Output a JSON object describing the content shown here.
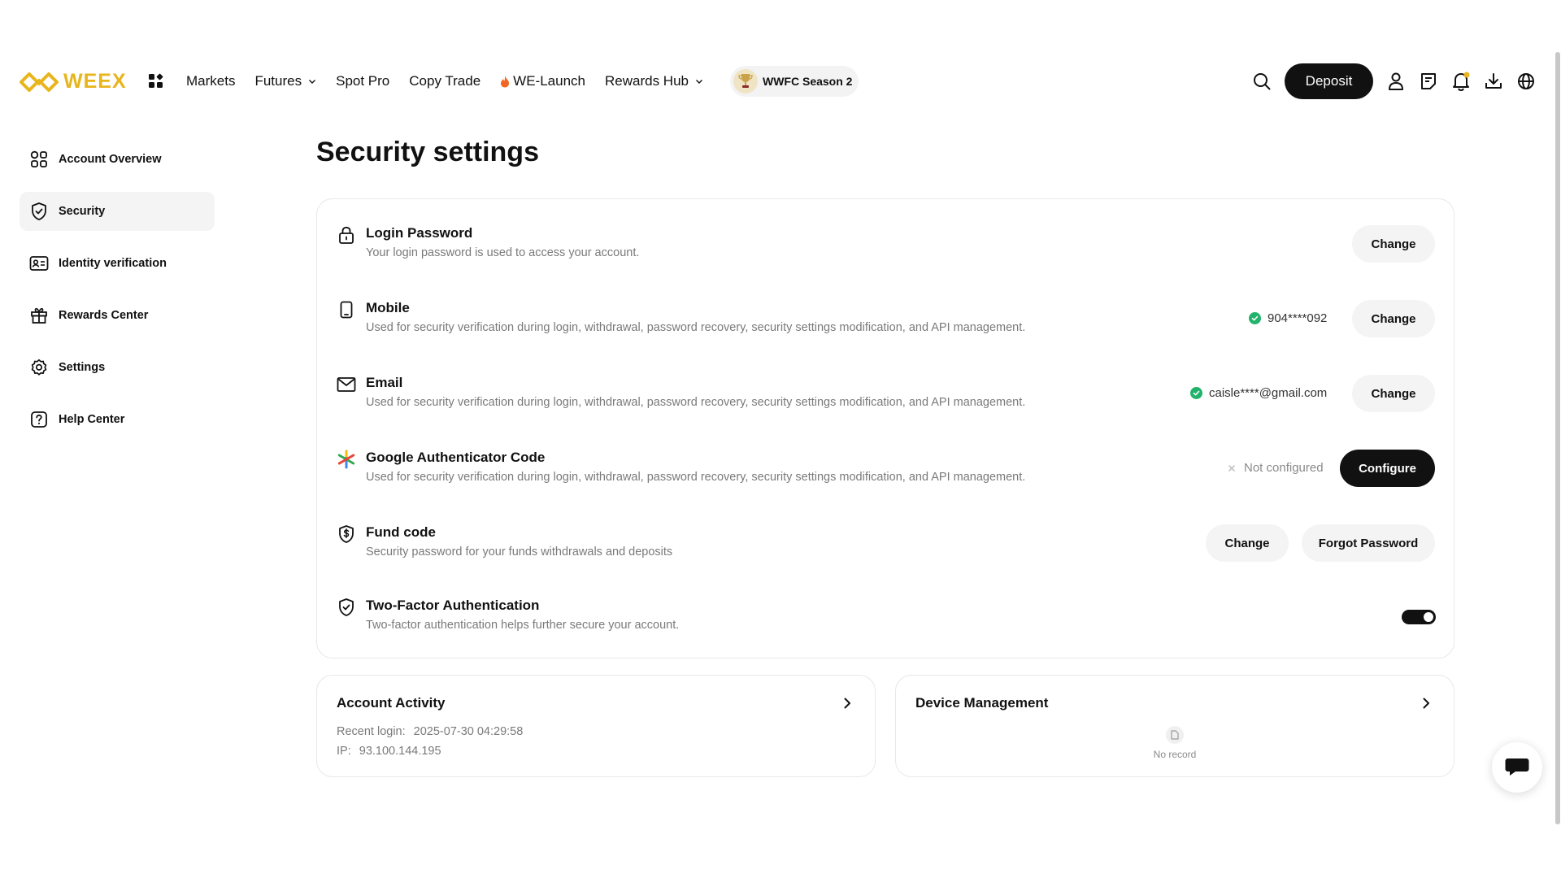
{
  "brand": {
    "name": "WEEX",
    "accent": "#e8b51c"
  },
  "nav": {
    "items": [
      {
        "label": "Markets",
        "has_dropdown": false
      },
      {
        "label": "Futures",
        "has_dropdown": true
      },
      {
        "label": "Spot Pro",
        "has_dropdown": false
      },
      {
        "label": "Copy Trade",
        "has_dropdown": false
      },
      {
        "label": "WE-Launch",
        "has_dropdown": false,
        "icon": "flame-icon"
      },
      {
        "label": "Rewards Hub",
        "has_dropdown": true
      }
    ],
    "season_label": "WWFC Season 2",
    "deposit_label": "Deposit",
    "icons": [
      "search-icon",
      "user-icon",
      "orders-icon",
      "bell-icon",
      "download-icon",
      "globe-icon"
    ]
  },
  "sidebar": {
    "items": [
      {
        "label": "Account Overview",
        "icon": "grid-icon",
        "active": false
      },
      {
        "label": "Security",
        "icon": "shield-icon",
        "active": true
      },
      {
        "label": "Identity verification",
        "icon": "id-card-icon",
        "active": false
      },
      {
        "label": "Rewards Center",
        "icon": "gift-icon",
        "active": false
      },
      {
        "label": "Settings",
        "icon": "gear-icon",
        "active": false
      },
      {
        "label": "Help Center",
        "icon": "help-icon",
        "active": false
      }
    ]
  },
  "page": {
    "title": "Security settings"
  },
  "security": {
    "login_password": {
      "title": "Login Password",
      "desc": "Your login password is used to access your account.",
      "action": "Change"
    },
    "mobile": {
      "title": "Mobile",
      "desc": "Used for security verification during login, withdrawal, password recovery, security settings modification, and API management.",
      "value": "904****092",
      "action": "Change"
    },
    "email": {
      "title": "Email",
      "desc": "Used for security verification during login, withdrawal, password recovery, security settings modification, and API management.",
      "value": "caisle****@gmail.com",
      "action": "Change"
    },
    "google_auth": {
      "title": "Google Authenticator Code",
      "desc": "Used for security verification during login, withdrawal, password recovery, security settings modification, and API management.",
      "status": "Not configured",
      "action": "Configure"
    },
    "fund_code": {
      "title": "Fund code",
      "desc": "Security password for your funds withdrawals and deposits",
      "action": "Change",
      "secondary_action": "Forgot Password"
    },
    "two_factor": {
      "title": "Two-Factor Authentication",
      "desc": "Two-factor authentication helps further secure your account.",
      "enabled": true
    }
  },
  "account_activity": {
    "title": "Account Activity",
    "recent_login_label": "Recent login:",
    "recent_login_value": "2025-07-30 04:29:58",
    "ip_label": "IP:",
    "ip_value": "93.100.144.195"
  },
  "device_management": {
    "title": "Device Management",
    "empty_text": "No record"
  }
}
